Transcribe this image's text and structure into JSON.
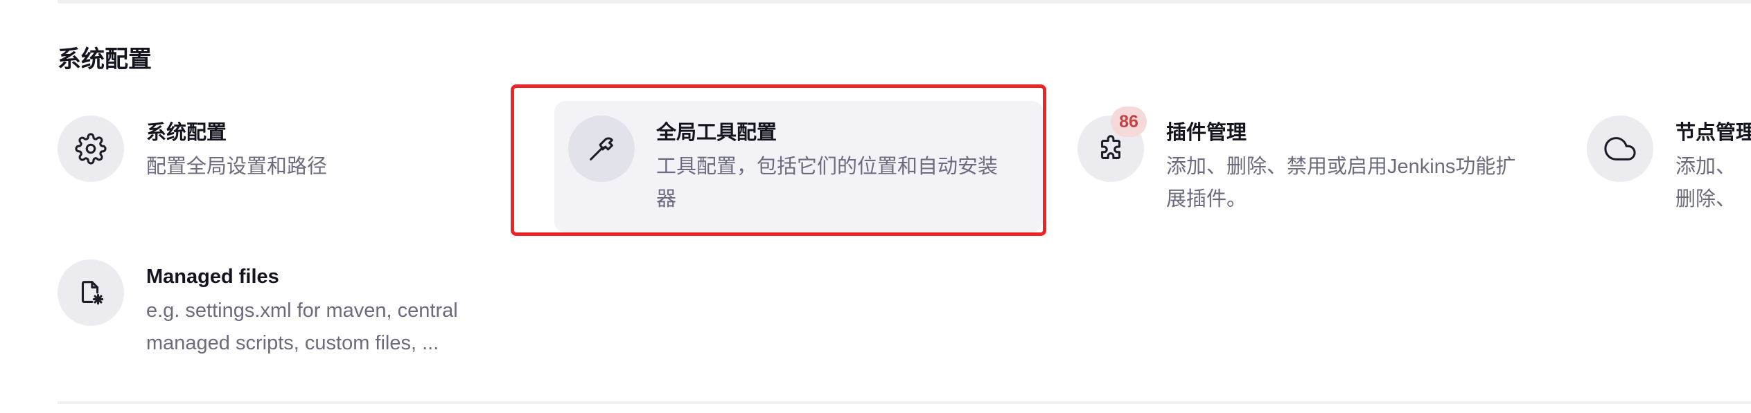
{
  "section": {
    "title": "系统配置"
  },
  "cards": [
    {
      "title": "系统配置",
      "description": "配置全局设置和路径",
      "icon": "gear-icon"
    },
    {
      "title": "全局工具配置",
      "description": "工具配置，包括它们的位置和自动安装器",
      "icon": "hammer-icon",
      "highlighted": true
    },
    {
      "title": "插件管理",
      "description": "添加、删除、禁用或启用Jenkins功能扩展插件。",
      "icon": "puzzle-icon",
      "badge": "86"
    },
    {
      "title": "节点管理",
      "description": "添加、删除、控制和监视系统运行任务的节点。",
      "icon": "cloud-icon"
    },
    {
      "title": "Managed files",
      "description": "e.g. settings.xml for maven, central managed scripts, custom files, ...",
      "icon": "file-gear-icon"
    }
  ],
  "colors": {
    "highlight": "#ee2323",
    "badge_bg": "#f6dada",
    "badge_text": "#c24545"
  }
}
